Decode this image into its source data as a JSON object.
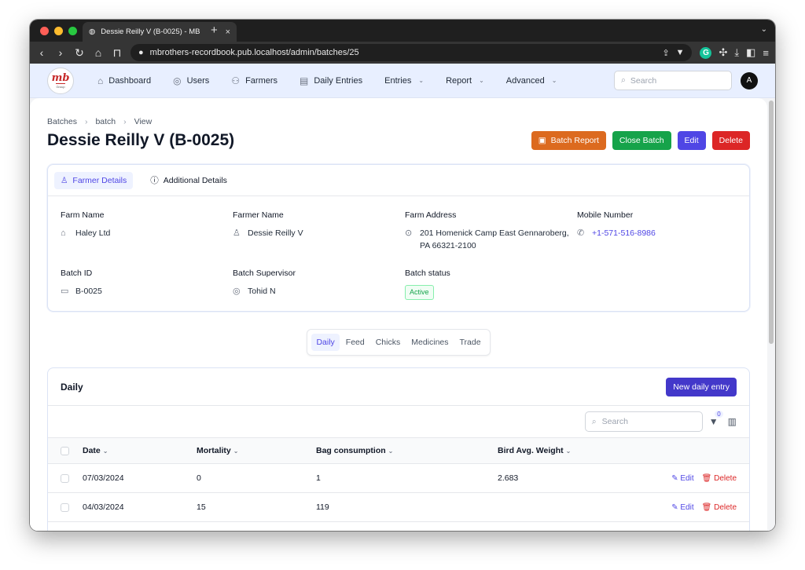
{
  "browser": {
    "tab_title": "Dessie Reilly V (B-0025) - MB",
    "new_tab": "+",
    "url": "mbrothers-recordbook.pub.localhost/admin/batches/25",
    "ext_g": "G"
  },
  "logo": {
    "text": "mb",
    "sub": "Group"
  },
  "nav": {
    "items": [
      {
        "label": "Dashboard",
        "icon": "⌂"
      },
      {
        "label": "Users",
        "icon": "◎"
      },
      {
        "label": "Farmers",
        "icon": "⚇"
      },
      {
        "label": "Daily Entries",
        "icon": "▤"
      },
      {
        "label": "Entries",
        "icon": ""
      },
      {
        "label": "Report",
        "icon": ""
      },
      {
        "label": "Advanced",
        "icon": ""
      }
    ],
    "search_placeholder": "Search",
    "avatar_letter": "A"
  },
  "breadcrumb": [
    "Batches",
    "batch",
    "View"
  ],
  "page_title": "Dessie Reilly V (B-0025)",
  "actions": {
    "batch_report": "Batch Report",
    "close_batch": "Close Batch",
    "edit": "Edit",
    "delete": "Delete"
  },
  "colors": {
    "batch_report": "#dc6a1f",
    "close_batch": "#16a34a",
    "edit": "#4f46e5",
    "delete": "#dc2626"
  },
  "details_tabs": {
    "farmer": "Farmer Details",
    "additional": "Additional Details"
  },
  "details": {
    "farm_name_label": "Farm Name",
    "farm_name": "Haley Ltd",
    "farmer_name_label": "Farmer Name",
    "farmer_name": "Dessie Reilly V",
    "farm_address_label": "Farm Address",
    "farm_address_line1": "201 Homenick Camp East Gennaroberg,",
    "farm_address_line2": "PA 66321-2100",
    "mobile_label": "Mobile Number",
    "mobile": "+1-571-516-8986",
    "batch_id_label": "Batch ID",
    "batch_id": "B-0025",
    "supervisor_label": "Batch Supervisor",
    "supervisor": "Tohid N",
    "status_label": "Batch status",
    "status": "Active"
  },
  "segments": [
    "Daily",
    "Feed",
    "Chicks",
    "Medicines",
    "Trade"
  ],
  "daily": {
    "title": "Daily",
    "new_entry": "New daily entry",
    "search_placeholder": "Search",
    "filter_count": "0",
    "columns": [
      "Date",
      "Mortality",
      "Bag consumption",
      "Bird Avg. Weight"
    ],
    "rows": [
      {
        "date": "07/03/2024",
        "mortality": "0",
        "bag": "1",
        "weight": "2.683"
      },
      {
        "date": "04/03/2024",
        "mortality": "15",
        "bag": "119",
        "weight": ""
      }
    ],
    "edit_label": "Edit",
    "delete_label": "Delete"
  }
}
